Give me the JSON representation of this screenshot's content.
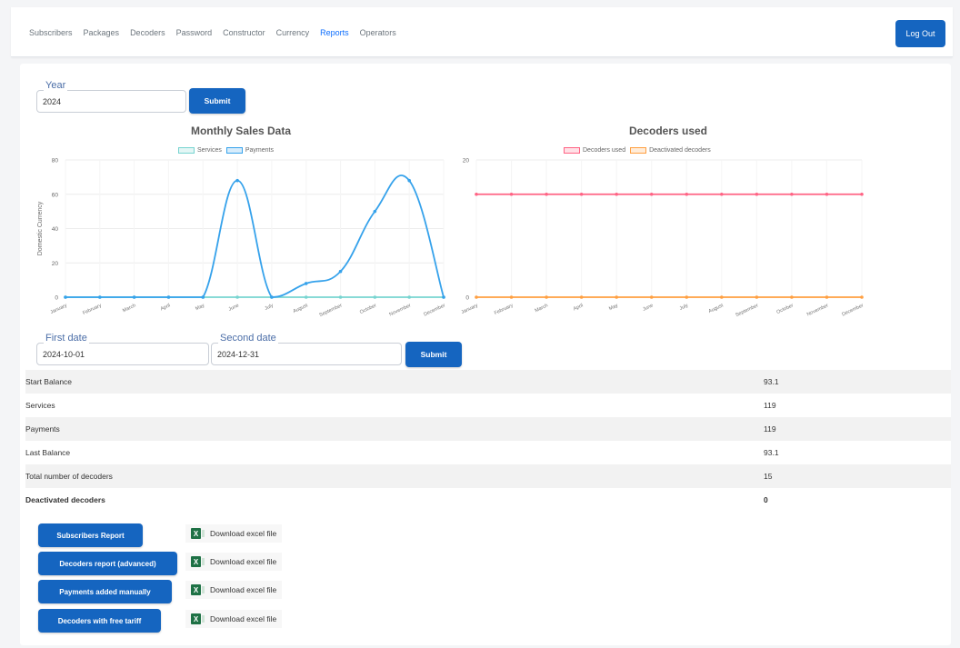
{
  "nav": {
    "links": [
      "Subscribers",
      "Packages",
      "Decoders",
      "Password",
      "Constructor",
      "Currency",
      "Reports",
      "Operators"
    ],
    "active": "Reports",
    "logout_label": "Log Out"
  },
  "year_form": {
    "legend": "Year",
    "value": "2024",
    "submit_label": "Submit"
  },
  "date_form": {
    "first_legend": "First date",
    "first_value": "2024-10-01",
    "second_legend": "Second date",
    "second_value": "2024-12-31",
    "submit_label": "Submit"
  },
  "chart_data": [
    {
      "type": "line",
      "title": "Monthly Sales Data",
      "ylabel": "Domestic Currency",
      "categories": [
        "January",
        "February",
        "March",
        "April",
        "May",
        "June",
        "July",
        "August",
        "September",
        "October",
        "November",
        "December"
      ],
      "series": [
        {
          "name": "Services",
          "color": "#77d4d0",
          "values": [
            0,
            0,
            0,
            0,
            0,
            0,
            0,
            0,
            0,
            0,
            0,
            0
          ]
        },
        {
          "name": "Payments",
          "color": "#36a2eb",
          "values": [
            0,
            0,
            0,
            0,
            0,
            68,
            0,
            8,
            15,
            50,
            68,
            0
          ]
        }
      ],
      "ylim": [
        0,
        80
      ],
      "yticks": [
        0,
        20,
        40,
        60,
        80
      ]
    },
    {
      "type": "line",
      "title": "Decoders used",
      "categories": [
        "January",
        "February",
        "March",
        "April",
        "May",
        "June",
        "July",
        "August",
        "September",
        "October",
        "November",
        "December"
      ],
      "series": [
        {
          "name": "Decoders used",
          "color": "#ff6384",
          "values": [
            15,
            15,
            15,
            15,
            15,
            15,
            15,
            15,
            15,
            15,
            15,
            15
          ]
        },
        {
          "name": "Deactivated decoders",
          "color": "#ff9f40",
          "values": [
            0,
            0,
            0,
            0,
            0,
            0,
            0,
            0,
            0,
            0,
            0,
            0
          ]
        }
      ],
      "ylim": [
        0,
        20
      ],
      "yticks": [
        0,
        20
      ]
    }
  ],
  "report_rows": [
    {
      "label": "Start Balance",
      "value": "93.1"
    },
    {
      "label": "Services",
      "value": "119"
    },
    {
      "label": "Payments",
      "value": "119"
    },
    {
      "label": "Last Balance",
      "value": "93.1"
    },
    {
      "label": "Total number of decoders",
      "value": "15"
    },
    {
      "label": "Deactivated decoders",
      "value": "0"
    }
  ],
  "reports": [
    {
      "label": "Subscribers Report",
      "download": "Download excel file"
    },
    {
      "label": "Decoders report (advanced)",
      "download": "Download excel file"
    },
    {
      "label": "Payments added manually",
      "download": "Download excel file"
    },
    {
      "label": "Decoders with free tariff",
      "download": "Download excel file"
    }
  ],
  "colors": {
    "primary": "#1565c0",
    "legend_text": "#4a6da7"
  },
  "icons": {
    "excel": "excel-file-icon"
  }
}
